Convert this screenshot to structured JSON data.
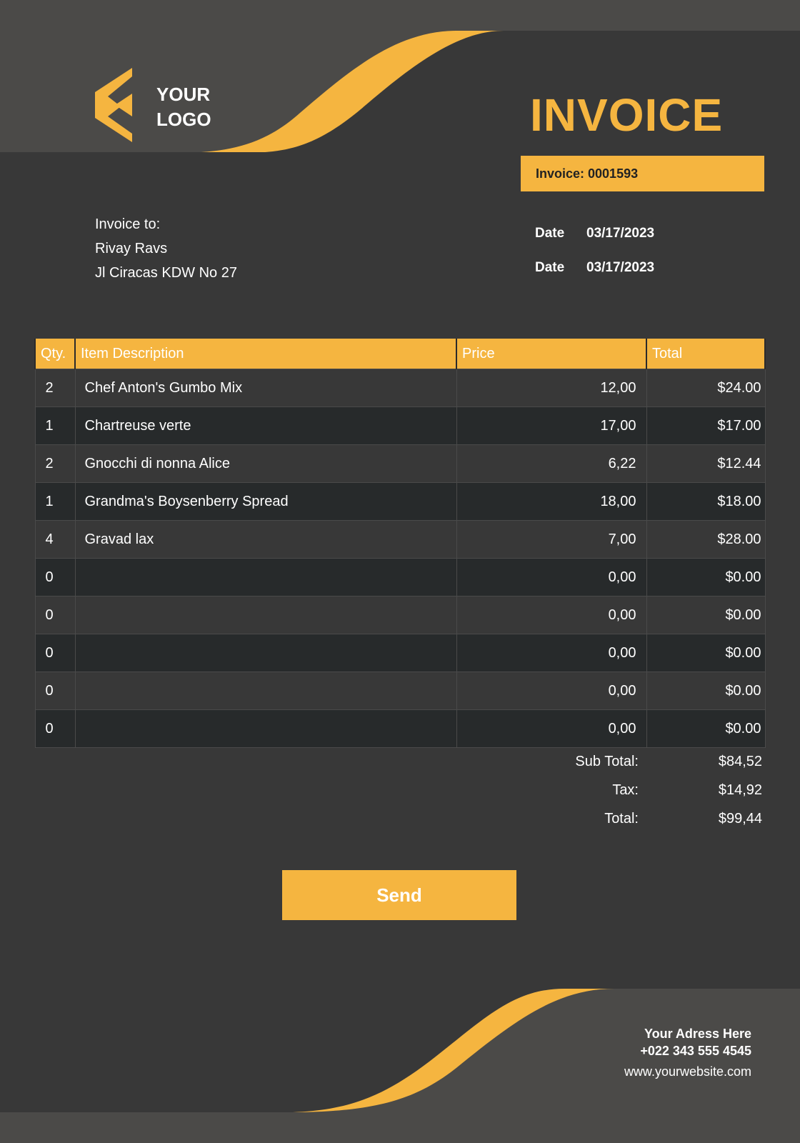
{
  "colors": {
    "accent": "#f5b540",
    "panel": "#383838",
    "light_band": "#4b4a48",
    "dark_row": "#272a2b",
    "text": "#ffffff"
  },
  "header": {
    "logo_line1": "YOUR",
    "logo_line2": "LOGO",
    "logo_icon": "chevron-left-icon",
    "title": "INVOICE",
    "invoice_number": "Invoice: 0001593"
  },
  "bill_to": {
    "label": "Invoice to:",
    "name": "Rivay Ravs",
    "address": "Jl Ciracas KDW No 27"
  },
  "dates": [
    {
      "label": "Date",
      "value": "03/17/2023"
    },
    {
      "label": "Date",
      "value": "03/17/2023"
    }
  ],
  "table": {
    "headers": {
      "qty": "Qty.",
      "desc": "Item Description",
      "price": "Price",
      "total": "Total"
    },
    "rows": [
      {
        "qty": "2",
        "desc": "Chef Anton's Gumbo Mix",
        "price": "12,00",
        "total": "$24.00"
      },
      {
        "qty": "1",
        "desc": "Chartreuse verte",
        "price": "17,00",
        "total": "$17.00"
      },
      {
        "qty": "2",
        "desc": "Gnocchi di nonna Alice",
        "price": "6,22",
        "total": "$12.44"
      },
      {
        "qty": "1",
        "desc": "Grandma's Boysenberry Spread",
        "price": "18,00",
        "total": "$18.00"
      },
      {
        "qty": "4",
        "desc": "Gravad lax",
        "price": "7,00",
        "total": "$28.00"
      },
      {
        "qty": "0",
        "desc": "",
        "price": "0,00",
        "total": "$0.00"
      },
      {
        "qty": "0",
        "desc": "",
        "price": "0,00",
        "total": "$0.00"
      },
      {
        "qty": "0",
        "desc": "",
        "price": "0,00",
        "total": "$0.00"
      },
      {
        "qty": "0",
        "desc": "",
        "price": "0,00",
        "total": "$0.00"
      },
      {
        "qty": "0",
        "desc": "",
        "price": "0,00",
        "total": "$0.00"
      }
    ]
  },
  "totals": {
    "subtotal_label": "Sub Total:",
    "subtotal": "$84,52",
    "tax_label": "Tax:",
    "tax": "$14,92",
    "total_label": "Total:",
    "total": "$99,44"
  },
  "send_label": "Send",
  "footer": {
    "address": "Your Adress Here",
    "phone": "+022 343 555 4545",
    "website": "www.yourwebsite.com"
  }
}
